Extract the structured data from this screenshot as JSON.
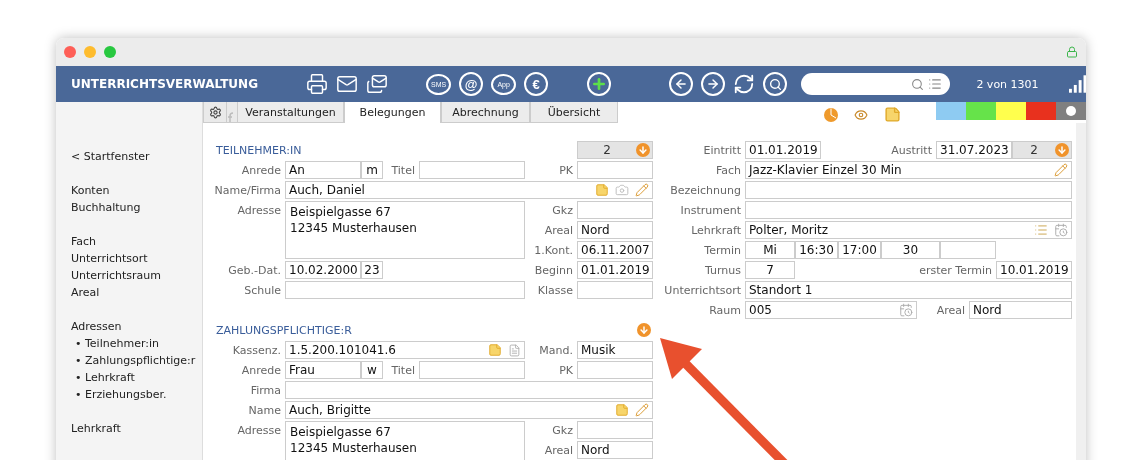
{
  "app_title": "UNTERRICHTSVERWALTUNG",
  "toolbar": {
    "buttons": [
      {
        "kind": "printer"
      },
      {
        "kind": "mail"
      },
      {
        "kind": "mails"
      },
      {
        "kind": "bubble",
        "label": "SMS"
      },
      {
        "kind": "glyph",
        "label": "@"
      },
      {
        "kind": "bubble",
        "label": "App"
      },
      {
        "kind": "glyph",
        "label": "€"
      },
      {
        "kind": "add"
      },
      {
        "kind": "back"
      },
      {
        "kind": "forward"
      },
      {
        "kind": "refresh"
      },
      {
        "kind": "search"
      }
    ],
    "record_counter": "2 von 1301"
  },
  "tabs": [
    {
      "label": "Veranstaltungen",
      "selected": false
    },
    {
      "label": "Belegungen",
      "selected": true
    },
    {
      "label": "Abrechnung",
      "selected": false
    },
    {
      "label": "Übersicht",
      "selected": false
    }
  ],
  "color_tags": [
    {
      "kind": "swatch",
      "color": "#8ecbf2"
    },
    {
      "kind": "swatch",
      "color": "#66e34a"
    },
    {
      "kind": "swatch",
      "color": "#ffff4d"
    },
    {
      "kind": "swatch",
      "color": "#e8311e"
    },
    {
      "kind": "dot",
      "color": "#808080"
    }
  ],
  "sidebar": {
    "groups": [
      [
        {
          "label": "< Startfenster"
        }
      ],
      [
        {
          "label": "Konten"
        },
        {
          "label": "Buchhaltung"
        }
      ],
      [
        {
          "label": "Fach"
        },
        {
          "label": "Unterrichtsort"
        },
        {
          "label": "Unterrichtsraum"
        },
        {
          "label": "Areal"
        }
      ],
      [
        {
          "label": "Adressen",
          "children": [
            "• Teilnehmer:in",
            "• Zahlungspflichtige:r",
            "• Lehrkraft",
            "• Erziehungsber."
          ]
        }
      ],
      [
        {
          "label": "Lehrkraft"
        }
      ]
    ]
  },
  "participant": {
    "title": "TEILNEHMER:IN",
    "counter": "2",
    "anrede": {
      "label": "Anrede",
      "value": "An",
      "suffix": "m"
    },
    "titel": {
      "label": "Titel"
    },
    "pk": {
      "label": "PK"
    },
    "name": {
      "label": "Name/Firma",
      "value": "Auch, Daniel"
    },
    "adresse": {
      "label": "Adresse",
      "lines": [
        "Beispielgasse 67",
        "12345 Musterhausen"
      ]
    },
    "gkz": {
      "label": "Gkz"
    },
    "areal": {
      "label": "Areal",
      "value": "Nord"
    },
    "kontakt": {
      "label": "1.Kont.",
      "value": "06.11.2007"
    },
    "geburt": {
      "label": "Geb.-Dat.",
      "value": "10.02.2000",
      "suffix": "23"
    },
    "beginn": {
      "label": "Beginn",
      "value": "01.01.2019"
    },
    "schule": {
      "label": "Schule"
    },
    "klasse": {
      "label": "Klasse"
    }
  },
  "payer": {
    "title": "ZAHLUNGSPFLICHTIGE:R",
    "kassenz": {
      "label": "Kassenz.",
      "value": "1.5.200.101041.6"
    },
    "mand": {
      "label": "Mand.",
      "value": "Musik"
    },
    "anrede": {
      "label": "Anrede",
      "value": "Frau",
      "suffix": "w"
    },
    "titel": {
      "label": "Titel"
    },
    "pk": {
      "label": "PK"
    },
    "firma": {
      "label": "Firma"
    },
    "name": {
      "label": "Name",
      "value": "Auch, Brigitte"
    },
    "adresse": {
      "label": "Adresse",
      "lines": [
        "Beispielgasse 67",
        "12345 Musterhausen"
      ]
    },
    "gkz": {
      "label": "Gkz"
    },
    "areal": {
      "label": "Areal",
      "value": "Nord"
    }
  },
  "booking": {
    "eintritt": {
      "label": "Eintritt",
      "value": "01.01.2019"
    },
    "austritt": {
      "label": "Austritt",
      "value": "31.07.2023"
    },
    "counter": "2",
    "fach": {
      "label": "Fach",
      "value": "Jazz-Klavier Einzel 30 Min"
    },
    "bezeichnung": {
      "label": "Bezeichnung"
    },
    "instrument": {
      "label": "Instrument"
    },
    "lehrkraft": {
      "label": "Lehrkraft",
      "value": "Polter, Moritz"
    },
    "termin": {
      "label": "Termin",
      "cells": [
        "Mi",
        "16:30",
        "17:00",
        "30"
      ]
    },
    "turnus": {
      "label": "Turnus",
      "value": "7"
    },
    "erster_termin": {
      "label": "erster Termin",
      "value": "10.01.2019"
    },
    "unterrichtsort": {
      "label": "Unterrichtsort",
      "value": "Standort 1"
    },
    "raum": {
      "label": "Raum",
      "value": "005"
    },
    "raum_areal": {
      "label": "Areal",
      "value": "Nord"
    }
  }
}
